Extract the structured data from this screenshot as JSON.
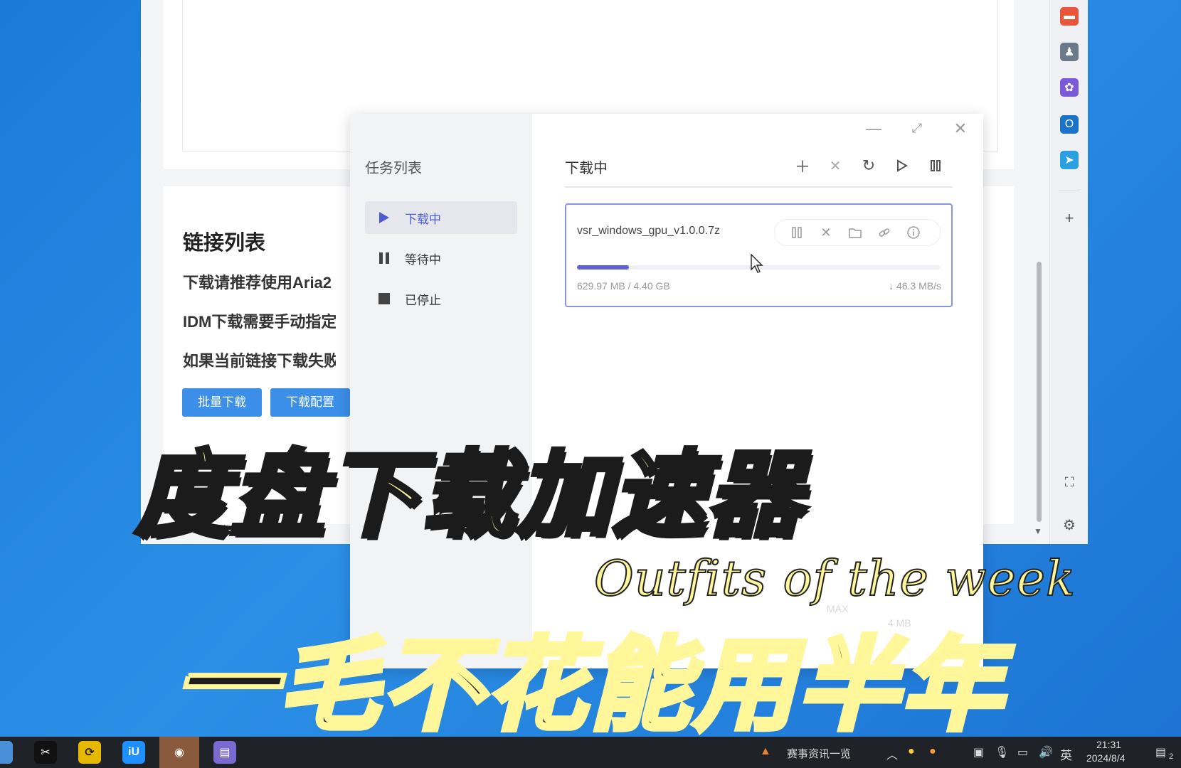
{
  "background_page": {
    "links_title": "链接列表",
    "lines": [
      "下载请推荐使用Aria2",
      "IDM下载需要手动指定",
      "如果当前链接下载失败"
    ],
    "buttons": {
      "batch_download": "批量下载",
      "download_config": "下载配置"
    }
  },
  "sidebar_right": {
    "plus_label": "+"
  },
  "download_manager": {
    "sidebar_title": "任务列表",
    "nav": [
      {
        "label": "下载中",
        "icon": "play-icon",
        "active": true
      },
      {
        "label": "等待中",
        "icon": "pause-icon",
        "active": false
      },
      {
        "label": "已停止",
        "icon": "stop-icon",
        "active": false
      }
    ],
    "main_title": "下载中",
    "task": {
      "name": "vsr_windows_gpu_v1.0.0.7z",
      "progress_fraction": 0.143,
      "size_text": "629.97 MB / 4.40 GB",
      "speed_text": "↓ 46.3 MB/s"
    }
  },
  "overlay": {
    "headline": "度盘下载加速器",
    "script_text": "Outfits of the week",
    "subline": "一毛不花能用半年",
    "ghost_max": "MAX",
    "ghost_mb": "4  MB"
  },
  "taskbar": {
    "news_label": "赛事资讯一览",
    "ime": "英",
    "time": "21:31",
    "date": "2024/8/4",
    "notification_count": "2"
  },
  "colors": {
    "accent": "#4a5bd6",
    "progress": "#5f5fd8",
    "caption_yellow": "#fff799",
    "button_blue": "#3b8fe8"
  }
}
